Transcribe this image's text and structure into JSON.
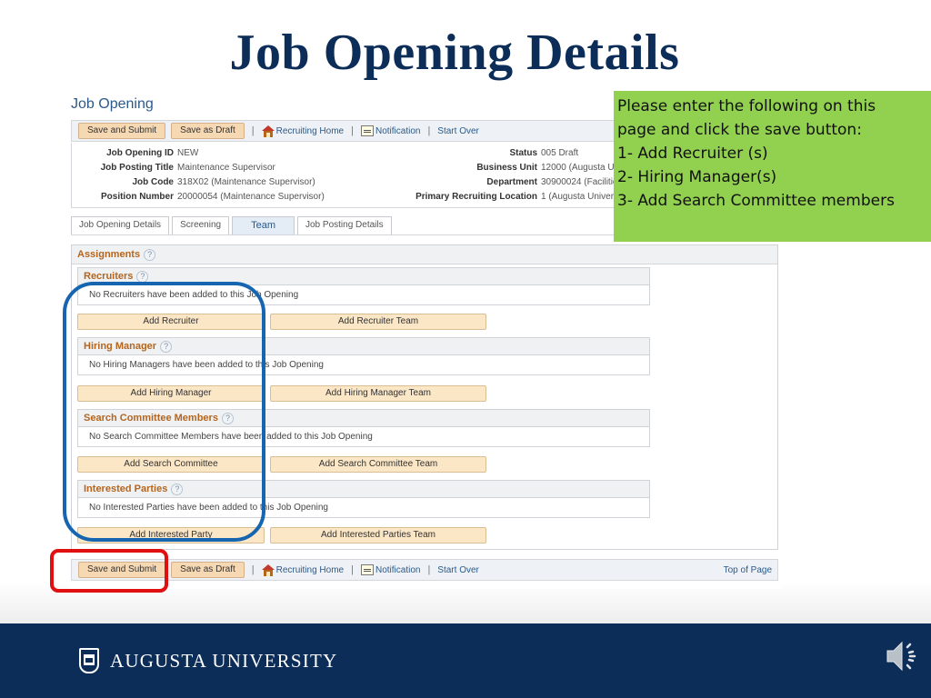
{
  "slide": {
    "title": "Job Opening Details",
    "footer_brand": "AUGUSTA UNIVERSITY"
  },
  "page": {
    "title": "Job Opening",
    "toolbar": {
      "save_submit": "Save and Submit",
      "save_draft": "Save as Draft",
      "separator": "|",
      "recruiting_home": "Recruiting Home",
      "notification": "Notification",
      "start_over": "Start Over",
      "top_of_page": "Top of Page"
    },
    "header_fields": {
      "left": [
        {
          "label": "Job Opening ID",
          "value": "NEW"
        },
        {
          "label": "Job Posting Title",
          "value": "Maintenance Supervisor"
        },
        {
          "label": "Job Code",
          "value": "318X02 (Maintenance Supervisor)"
        },
        {
          "label": "Position Number",
          "value": "20000054 (Maintenance Supervisor)"
        }
      ],
      "right": [
        {
          "label": "Status",
          "value": "005 Draft"
        },
        {
          "label": "Business Unit",
          "value": "12000 (Augusta U"
        },
        {
          "label": "Department",
          "value": "30900024 (Facilitie"
        },
        {
          "label": "Primary Recruiting Location",
          "value": "1 (Augusta Univer"
        }
      ]
    },
    "tabs": [
      {
        "label": "Job Opening Details",
        "active": false
      },
      {
        "label": "Screening",
        "active": false
      },
      {
        "label": "Team",
        "active": true
      },
      {
        "label": "Job Posting Details",
        "active": false
      }
    ],
    "assignments": {
      "title": "Assignments",
      "help": "?",
      "sections": [
        {
          "title": "Recruiters",
          "empty_text": "No Recruiters have been added to this Job Opening",
          "add_button": "Add Recruiter",
          "team_button": "Add Recruiter Team"
        },
        {
          "title": "Hiring Manager",
          "empty_text": "No Hiring Managers have been added to this Job Opening",
          "add_button": "Add Hiring Manager",
          "team_button": "Add Hiring Manager Team"
        },
        {
          "title": "Search Committee Members",
          "empty_text": "No Search Committee Members have been added to this Job Opening",
          "add_button": "Add Search Committee",
          "team_button": "Add Search Committee Team"
        },
        {
          "title": "Interested Parties",
          "empty_text": "No Interested Parties have been added to this Job Opening",
          "add_button": "Add Interested Party",
          "team_button": "Add Interested Parties Team"
        }
      ]
    }
  },
  "callout": {
    "lines": [
      "Please enter the following on this",
      "page and click the save button:",
      "1- Add Recruiter (s)",
      "2- Hiring Manager(s)",
      "3- Add Search Committee members"
    ],
    "color": "#92d050"
  },
  "annotations": {
    "oval_color": "#1565b0",
    "box_color": "#e01010"
  },
  "icons": {
    "home": "house-icon",
    "notification": "notification-icon",
    "help": "help-icon",
    "audio": "speaker-icon",
    "logo": "shield-icon"
  }
}
